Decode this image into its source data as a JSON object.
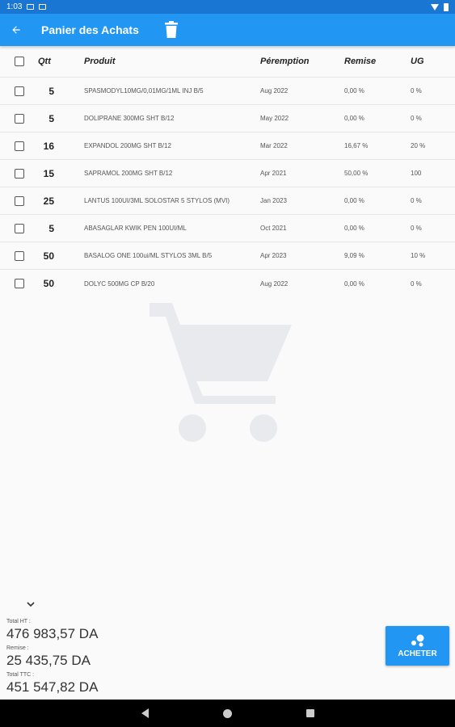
{
  "status_bar": {
    "time": "1:03"
  },
  "app_bar": {
    "title": "Panier des Achats"
  },
  "table": {
    "headers": {
      "quantity": "Qtt",
      "product": "Produit",
      "expiry": "Péremption",
      "discount": "Remise",
      "ug": "UG"
    },
    "rows": [
      {
        "qty": "5",
        "product": "SPASMODYL10MG/0,01MG/1ML  INJ B/5",
        "expiry": "Aug 2022",
        "discount": "0,00 %",
        "ug": "0 %"
      },
      {
        "qty": "5",
        "product": "DOLIPRANE 300MG SHT B/12",
        "expiry": "May 2022",
        "discount": "0,00 %",
        "ug": "0 %"
      },
      {
        "qty": "16",
        "product": "EXPANDOL 200MG SHT B/12",
        "expiry": "Mar 2022",
        "discount": "16,67 %",
        "ug": "20 %"
      },
      {
        "qty": "15",
        "product": "SAPRAMOL 200MG SHT B/12",
        "expiry": "Apr 2021",
        "discount": "50,00 %",
        "ug": "100"
      },
      {
        "qty": "25",
        "product": "LANTUS 100UI/3ML SOLOSTAR  5 STYLOS (MVI)",
        "expiry": "Jan 2023",
        "discount": "0,00 %",
        "ug": "0 %"
      },
      {
        "qty": "5",
        "product": "ABASAGLAR KWIK PEN 100UI/ML",
        "expiry": "Oct 2021",
        "discount": "0,00 %",
        "ug": "0 %"
      },
      {
        "qty": "50",
        "product": "BASALOG ONE 100ui/ML STYLOS  3ML B/5",
        "expiry": "Apr 2023",
        "discount": "9,09 %",
        "ug": "10 %"
      },
      {
        "qty": "50",
        "product": "DOLYC 500MG CP B/20",
        "expiry": "Aug 2022",
        "discount": "0,00 %",
        "ug": "0 %"
      }
    ]
  },
  "totals": {
    "ht_label": "Total HT :",
    "ht_value": "476 983,57 DA",
    "remise_label": "Remise :",
    "remise_value": "25 435,75 DA",
    "ttc_label": "Total TTC :",
    "ttc_value": "451 547,82 DA"
  },
  "buy_button": {
    "label": "ACHETER"
  },
  "colors": {
    "primary": "#2196f3",
    "status_bar": "#1976d2"
  },
  "icons": {
    "back": "arrow-left-icon",
    "delete": "trash-icon",
    "watermark": "shopping-cart-icon",
    "expand": "chevron-down-icon",
    "buy": "bubbles-icon"
  }
}
